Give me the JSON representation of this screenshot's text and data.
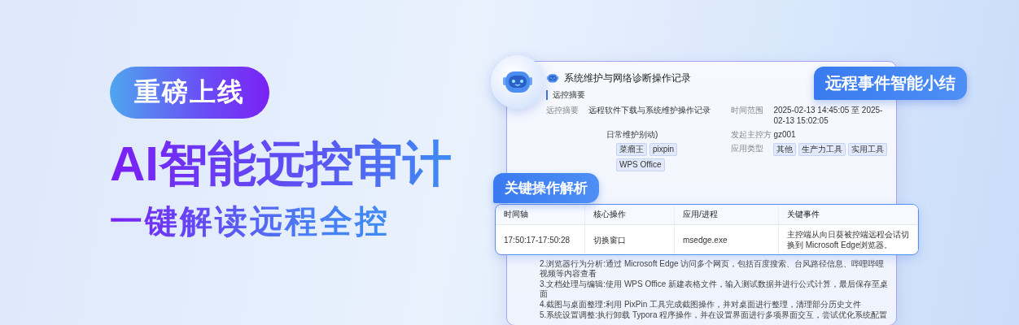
{
  "promo": {
    "badge": "重磅上线",
    "headline": "AI智能远控审计",
    "subheadline": "一键解读远程全控"
  },
  "summary_card": {
    "title": "系统维护与网络诊断操作记录",
    "section": "远控摘要",
    "info": [
      {
        "label": "远控摘要",
        "value": "远程软件下载与系统维护操作记录"
      },
      {
        "label": "时间范围",
        "value": "2025-02-13 14:45:05 至 2025-02-13 15:02:05"
      },
      {
        "value": "日常维护别动)"
      },
      {
        "label": "发起主控方",
        "value": "gz001"
      },
      {
        "tags": [
          "菜瘤王",
          "pixpin",
          "WPS Office"
        ]
      },
      {
        "label": "应用类型",
        "tags": [
          "其他",
          "生产力工具",
          "实用工具"
        ]
      }
    ],
    "steps": [
      "2.浏览器行为分析:通过 Microsoft Edge 访问多个网页，包括百度搜索、台风路径信息、哔哩哔哩视频等内容查看",
      "3.文档处理与编辑:使用 WPS Office 新建表格文件，输入测试数据并进行公式计算，最后保存至桌面",
      "4.截图与桌面整理:利用 PixPin 工具完成截图操作，并对桌面进行整理，清理部分历史文件",
      "5.系统设置调整:执行卸载 Typora 程序操作，并在设置界面进行多项界面交互，尝试优化系统配置"
    ]
  },
  "summary_tag": "远程事件智能小结",
  "analysis_tag": "关键操作解析",
  "table": {
    "columns": [
      "时间轴",
      "核心操作",
      "应用/进程",
      "关键事件"
    ],
    "rows": [
      {
        "cells": [
          "17:50:17-17:50:28",
          "切换窗口",
          "msedge.exe",
          "主控端从向日葵被控端远程会话切换到 Microsoft Edge浏览器。"
        ]
      }
    ]
  }
}
